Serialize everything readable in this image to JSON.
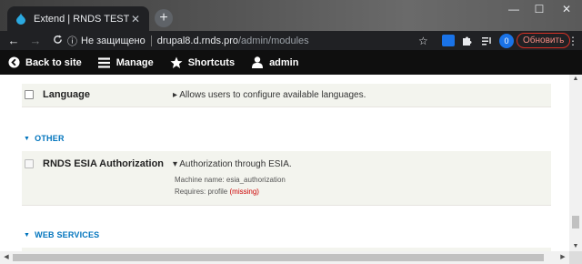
{
  "browser": {
    "tab_title": "Extend | RNDS TEST",
    "new_tab": "+",
    "tab_close": "✕",
    "window": {
      "minimize": "—",
      "maximize": "☐",
      "close": "✕"
    },
    "nav": {
      "back": "←",
      "forward": "→",
      "reload": "C"
    },
    "security_text": "Не защищено",
    "url_host": "drupal8.d.rnds.pro",
    "url_path": "/admin/modules",
    "profile_initial": "0",
    "update_label": "Обновить",
    "menu": "⋮",
    "star": "☆"
  },
  "drupal_toolbar": {
    "back_to_site": "Back to site",
    "manage": "Manage",
    "shortcuts": "Shortcuts",
    "user": "admin"
  },
  "modules": {
    "language": {
      "name": "Language",
      "description": "▸ Allows users to configure available languages."
    },
    "other_section": "OTHER",
    "esia": {
      "name": "RNDS ESIA Authorization",
      "description": "▾ Authorization through ESIA.",
      "machine_name": "Machine name: esia_authorization",
      "requires_prefix": "Requires: profile ",
      "requires_missing": "(missing)"
    },
    "web_services_section": "WEB SERVICES"
  },
  "colors": {
    "accent": "#0074bd",
    "missing": "#cc0000",
    "row_bg": "#f3f4ee"
  }
}
